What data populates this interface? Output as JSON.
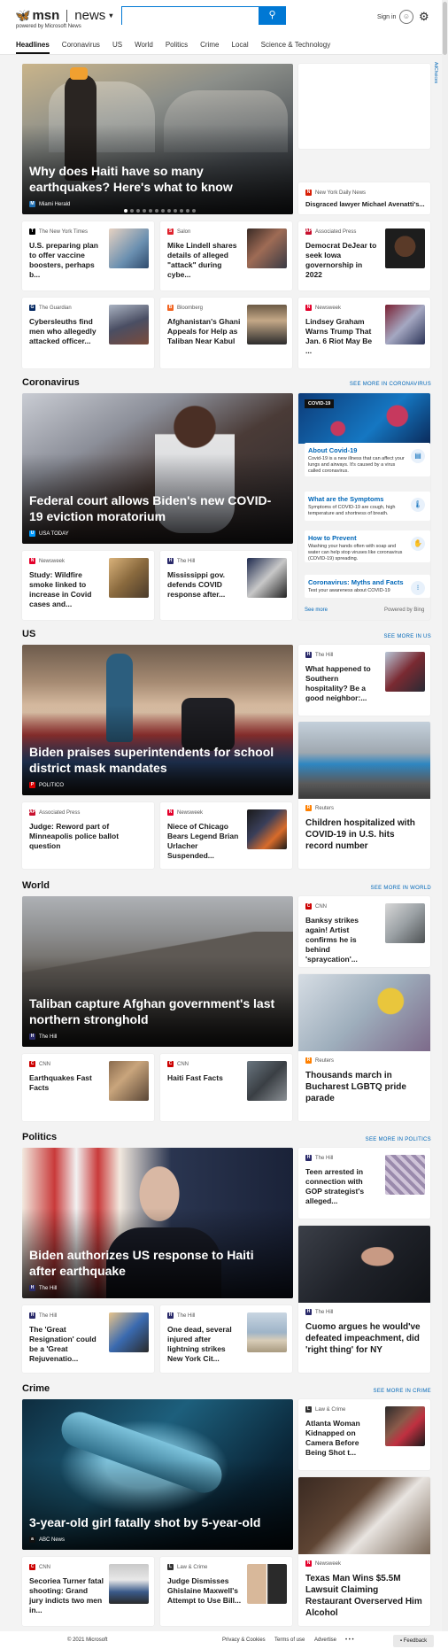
{
  "header": {
    "logo_brand": "msn",
    "logo_section": "news",
    "powered_by": "powered by Microsoft News",
    "search_placeholder": "",
    "signin": "Sign in"
  },
  "nav": [
    "Headlines",
    "Coronavirus",
    "US",
    "World",
    "Politics",
    "Crime",
    "Local",
    "Science & Technology"
  ],
  "adchoices": "AdChoices",
  "top": {
    "hero": {
      "title": "Why does Haiti have so many earthquakes? Here's what to know",
      "source": "Miami Herald"
    },
    "side": {
      "source": "New York Daily News",
      "title": "Disgraced lawyer Michael Avenatti's..."
    },
    "cards": [
      {
        "source": "The New York Times",
        "title": "U.S. preparing plan to offer vaccine boosters, perhaps b..."
      },
      {
        "source": "Salon",
        "title": "Mike Lindell shares details of alleged \"attack\" during cybe..."
      },
      {
        "source": "Associated Press",
        "title": "Democrat DeJear to seek Iowa governorship in 2022"
      },
      {
        "source": "The Guardian",
        "title": "Cybersleuths find men who allegedly attacked officer..."
      },
      {
        "source": "Bloomberg",
        "title": "Afghanistan's Ghani Appeals for Help as Taliban Near Kabul"
      },
      {
        "source": "Newsweek",
        "title": "Lindsey Graham Warns Trump That Jan. 6 Riot May Be ..."
      }
    ]
  },
  "coronavirus": {
    "title": "Coronavirus",
    "see_more": "SEE MORE IN CORONAVIRUS",
    "hero": {
      "title": "Federal court allows Biden's new COVID-19 eviction moratorium",
      "source": "USA TODAY"
    },
    "cards": [
      {
        "source": "Newsweek",
        "title": "Study: Wildfire smoke linked to increase in Covid cases and..."
      },
      {
        "source": "The Hill",
        "title": "Mississippi gov. defends COVID response after..."
      }
    ],
    "panel": {
      "badge": "COVID-19",
      "items": [
        {
          "title": "About Covid-19",
          "desc": "Covid-19 is a new illness that can affect your lungs and airways. It's caused by a virus called coronavirus."
        },
        {
          "title": "What are the Symptoms",
          "desc": "Symptoms of COVID-19 are cough, high temperature and shortness of breath."
        },
        {
          "title": "How to Prevent",
          "desc": "Washing your hands often with soap and water can help stop viruses like coronavirus (COVID-19) spreading."
        },
        {
          "title": "Coronavirus: Myths and Facts",
          "desc": "Test your awareness about COVID-19"
        }
      ],
      "see_more": "See more",
      "powered": "Powered by Bing"
    }
  },
  "us": {
    "title": "US",
    "see_more": "SEE MORE IN US",
    "hero": {
      "title": "Biden praises superintendents for school district mask mandates",
      "source": "POLITICO"
    },
    "side": {
      "source": "The Hill",
      "title": "What happened to Southern hospitality? Be a good neighbor:..."
    },
    "big": {
      "source": "Reuters",
      "title": "Children hospitalized with COVID-19 in U.S. hits record number"
    },
    "cards": [
      {
        "source": "Associated Press",
        "title": "Judge: Reword part of Minneapolis police ballot question"
      },
      {
        "source": "Newsweek",
        "title": "Niece of Chicago Bears Legend Brian Urlacher Suspended..."
      }
    ]
  },
  "world": {
    "title": "World",
    "see_more": "SEE MORE IN WORLD",
    "hero": {
      "title": "Taliban capture Afghan government's last northern stronghold",
      "source": "The Hill"
    },
    "side": {
      "source": "CNN",
      "title": "Banksy strikes again! Artist confirms he is behind 'spraycation'..."
    },
    "big": {
      "source": "Reuters",
      "title": "Thousands march in Bucharest LGBTQ pride parade"
    },
    "cards": [
      {
        "source": "CNN",
        "title": "Earthquakes Fast Facts"
      },
      {
        "source": "CNN",
        "title": "Haiti Fast Facts"
      }
    ]
  },
  "politics": {
    "title": "Politics",
    "see_more": "SEE MORE IN POLITICS",
    "hero": {
      "title": "Biden authorizes US response to Haiti after earthquake",
      "source": "The Hill"
    },
    "side": {
      "source": "The Hill",
      "title": "Teen arrested in connection with GOP strategist's alleged..."
    },
    "big": {
      "source": "The Hill",
      "title": "Cuomo argues he would've defeated impeachment, did 'right thing' for NY"
    },
    "cards": [
      {
        "source": "The Hill",
        "title": "The 'Great Resignation' could be a 'Great Rejuvenatio..."
      },
      {
        "source": "The Hill",
        "title": "One dead, several injured after lightning strikes New York Cit..."
      }
    ]
  },
  "crime": {
    "title": "Crime",
    "see_more": "SEE MORE IN CRIME",
    "hero": {
      "title": "3-year-old girl fatally shot by 5-year-old",
      "source": "ABC News"
    },
    "side": {
      "source": "Law & Crime",
      "title": "Atlanta Woman Kidnapped on Camera Before Being Shot t..."
    },
    "big": {
      "source": "Newsweek",
      "title": "Texas Man Wins $5.5M Lawsuit Claiming Restaurant Overserved Him Alcohol"
    },
    "cards": [
      {
        "source": "CNN",
        "title": "Secoriea Turner fatal shooting: Grand jury indicts two men in..."
      },
      {
        "source": "Law & Crime",
        "title": "Judge Dismisses Ghislaine Maxwell's Attempt to Use Bill..."
      }
    ]
  },
  "footer": {
    "copyright": "© 2021 Microsoft",
    "privacy": "Privacy & Cookies",
    "terms": "Terms of use",
    "advertise": "Advertise",
    "more": "• • •",
    "feedback": "Feedback"
  }
}
